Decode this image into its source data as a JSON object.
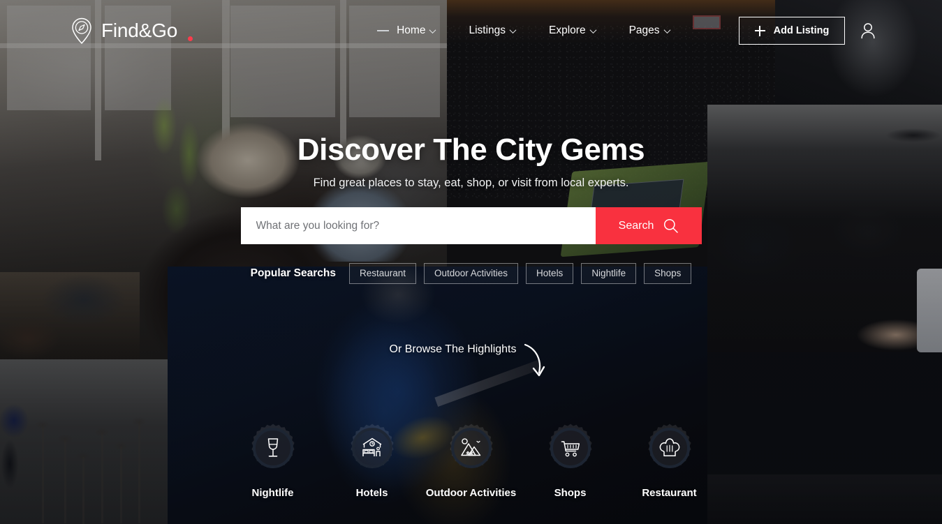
{
  "brand": {
    "name": "Find&Go",
    "logo_icon": "map-pin-compass-icon",
    "dot_color": "#f93c4c"
  },
  "header": {
    "nav": [
      {
        "label": "Home",
        "has_chevron": true,
        "active": true
      },
      {
        "label": "Listings",
        "has_chevron": true,
        "active": false
      },
      {
        "label": "Explore",
        "has_chevron": true,
        "active": false
      },
      {
        "label": "Pages",
        "has_chevron": true,
        "active": false
      }
    ],
    "add_listing_label": "Add Listing",
    "add_listing_icon": "plus-icon",
    "account_icon": "user-icon"
  },
  "hero": {
    "title": "Discover The City Gems",
    "subtitle": "Find great places to stay, eat, shop, or visit from local experts.",
    "search": {
      "placeholder": "What are you looking for?",
      "value": "",
      "button_label": "Search",
      "button_icon": "search-icon",
      "button_color": "#f9313f"
    },
    "popular": {
      "label": "Popular Searchs",
      "tags": [
        "Restaurant",
        "Outdoor Activities",
        "Hotels",
        "Nightlife",
        "Shops"
      ]
    },
    "browse": {
      "text": "Or Browse The Highlights",
      "icon": "curved-down-arrow-icon"
    },
    "categories": [
      {
        "label": "Nightlife",
        "icon": "wine-glass-icon"
      },
      {
        "label": "Hotels",
        "icon": "hotel-bed-icon"
      },
      {
        "label": "Outdoor Activities",
        "icon": "mountain-icon"
      },
      {
        "label": "Shops",
        "icon": "shopping-cart-icon"
      },
      {
        "label": "Restaurant",
        "icon": "chef-hat-icon"
      }
    ]
  }
}
